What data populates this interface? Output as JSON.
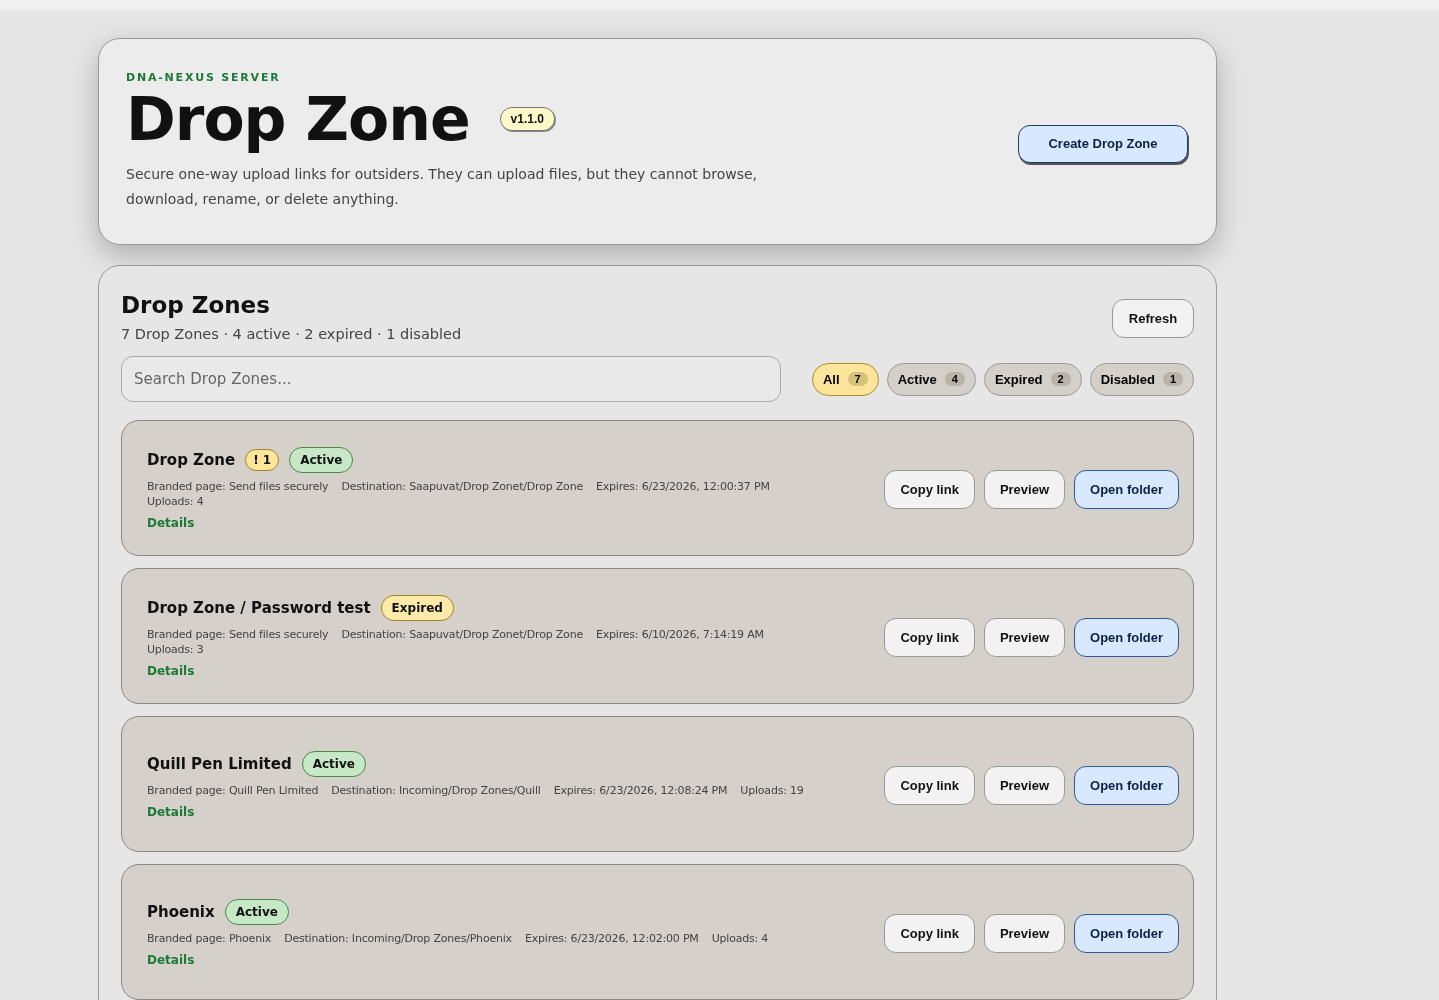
{
  "header": {
    "eyebrow": "DNA-NEXUS SERVER",
    "title": "Drop Zone",
    "version": "v1.1.0",
    "description": "Secure one-way upload links for outsiders. They can upload files, but they cannot browse, download, rename, or delete anything.",
    "create_button": "Create Drop Zone"
  },
  "panel": {
    "title": "Drop Zones",
    "summary": "7 Drop Zones · 4 active · 2 expired · 1 disabled",
    "refresh_button": "Refresh",
    "search": {
      "placeholder": "Search Drop Zones..."
    },
    "filters": [
      {
        "label": "All",
        "count": "7",
        "selected": true
      },
      {
        "label": "Active",
        "count": "4",
        "selected": false
      },
      {
        "label": "Expired",
        "count": "2",
        "selected": false
      },
      {
        "label": "Disabled",
        "count": "1",
        "selected": false
      }
    ]
  },
  "zones": [
    {
      "name": "Drop Zone",
      "warning": "! 1",
      "status": {
        "label": "Active",
        "kind": "active"
      },
      "meta": [
        "Branded page: Send files securely",
        "Destination: Saapuvat/Drop Zonet/Drop Zone",
        "Expires: 6/23/2026, 12:00:37 PM",
        "Uploads: 4"
      ],
      "details": "Details",
      "actions": [
        "Copy link",
        "Preview",
        "Open folder"
      ]
    },
    {
      "name": "Drop Zone / Password test",
      "status": {
        "label": "Expired",
        "kind": "expired"
      },
      "meta": [
        "Branded page: Send files securely",
        "Destination: Saapuvat/Drop Zonet/Drop Zone",
        "Expires: 6/10/2026, 7:14:19 AM",
        "Uploads: 3"
      ],
      "details": "Details",
      "actions": [
        "Copy link",
        "Preview",
        "Open folder"
      ]
    },
    {
      "name": "Quill Pen Limited",
      "status": {
        "label": "Active",
        "kind": "active"
      },
      "meta": [
        "Branded page: Quill Pen Limited",
        "Destination: Incoming/Drop Zones/Quill",
        "Expires: 6/23/2026, 12:08:24 PM",
        "Uploads: 19"
      ],
      "details": "Details",
      "actions": [
        "Copy link",
        "Preview",
        "Open folder"
      ]
    },
    {
      "name": "Phoenix",
      "status": {
        "label": "Active",
        "kind": "active"
      },
      "meta": [
        "Branded page: Phoenix",
        "Destination: Incoming/Drop Zones/Phoenix",
        "Expires: 6/23/2026, 12:02:00 PM",
        "Uploads: 4"
      ],
      "details": "Details",
      "actions": [
        "Copy link",
        "Preview",
        "Open folder"
      ]
    }
  ]
}
